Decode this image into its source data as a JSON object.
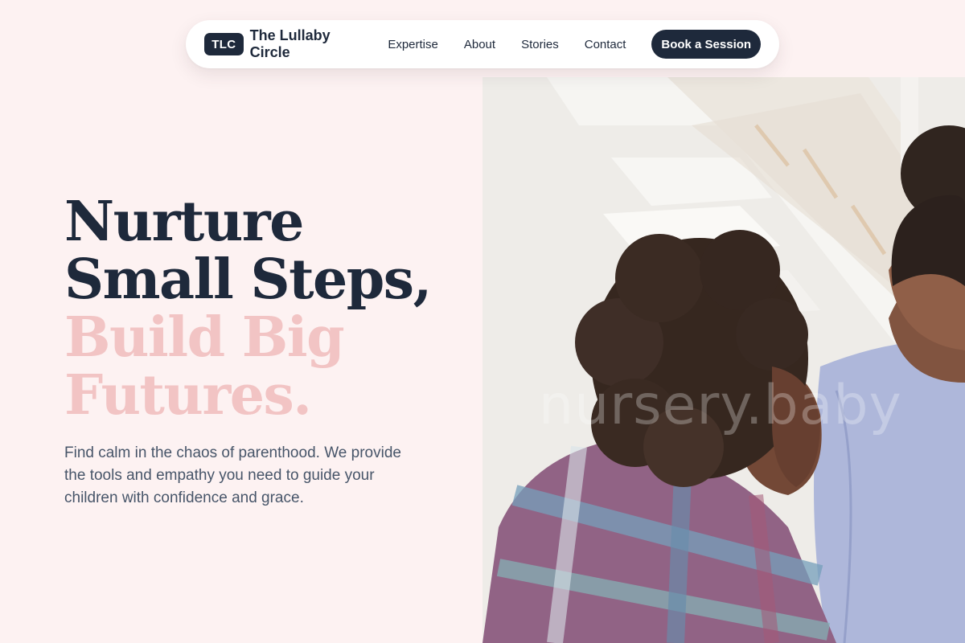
{
  "nav": {
    "logo_badge": "TLC",
    "brand_name": "The Lullaby Circle",
    "links": [
      "Expertise",
      "About",
      "Stories",
      "Contact"
    ],
    "cta_label": "Book a Session"
  },
  "hero": {
    "title_dark": [
      "Nurture",
      "Small Steps,"
    ],
    "title_pink": [
      "Build Big",
      "Futures."
    ],
    "subtitle": "Find calm in the chaos of parenthood. We provide the tools and empathy you need to guide your children with confidence and grace.",
    "watermark": "nursery.baby"
  },
  "colors": {
    "background": "#fdf2f2",
    "navy": "#1e293b",
    "pink_accent": "#f2c4c4",
    "body_text": "#475569"
  }
}
